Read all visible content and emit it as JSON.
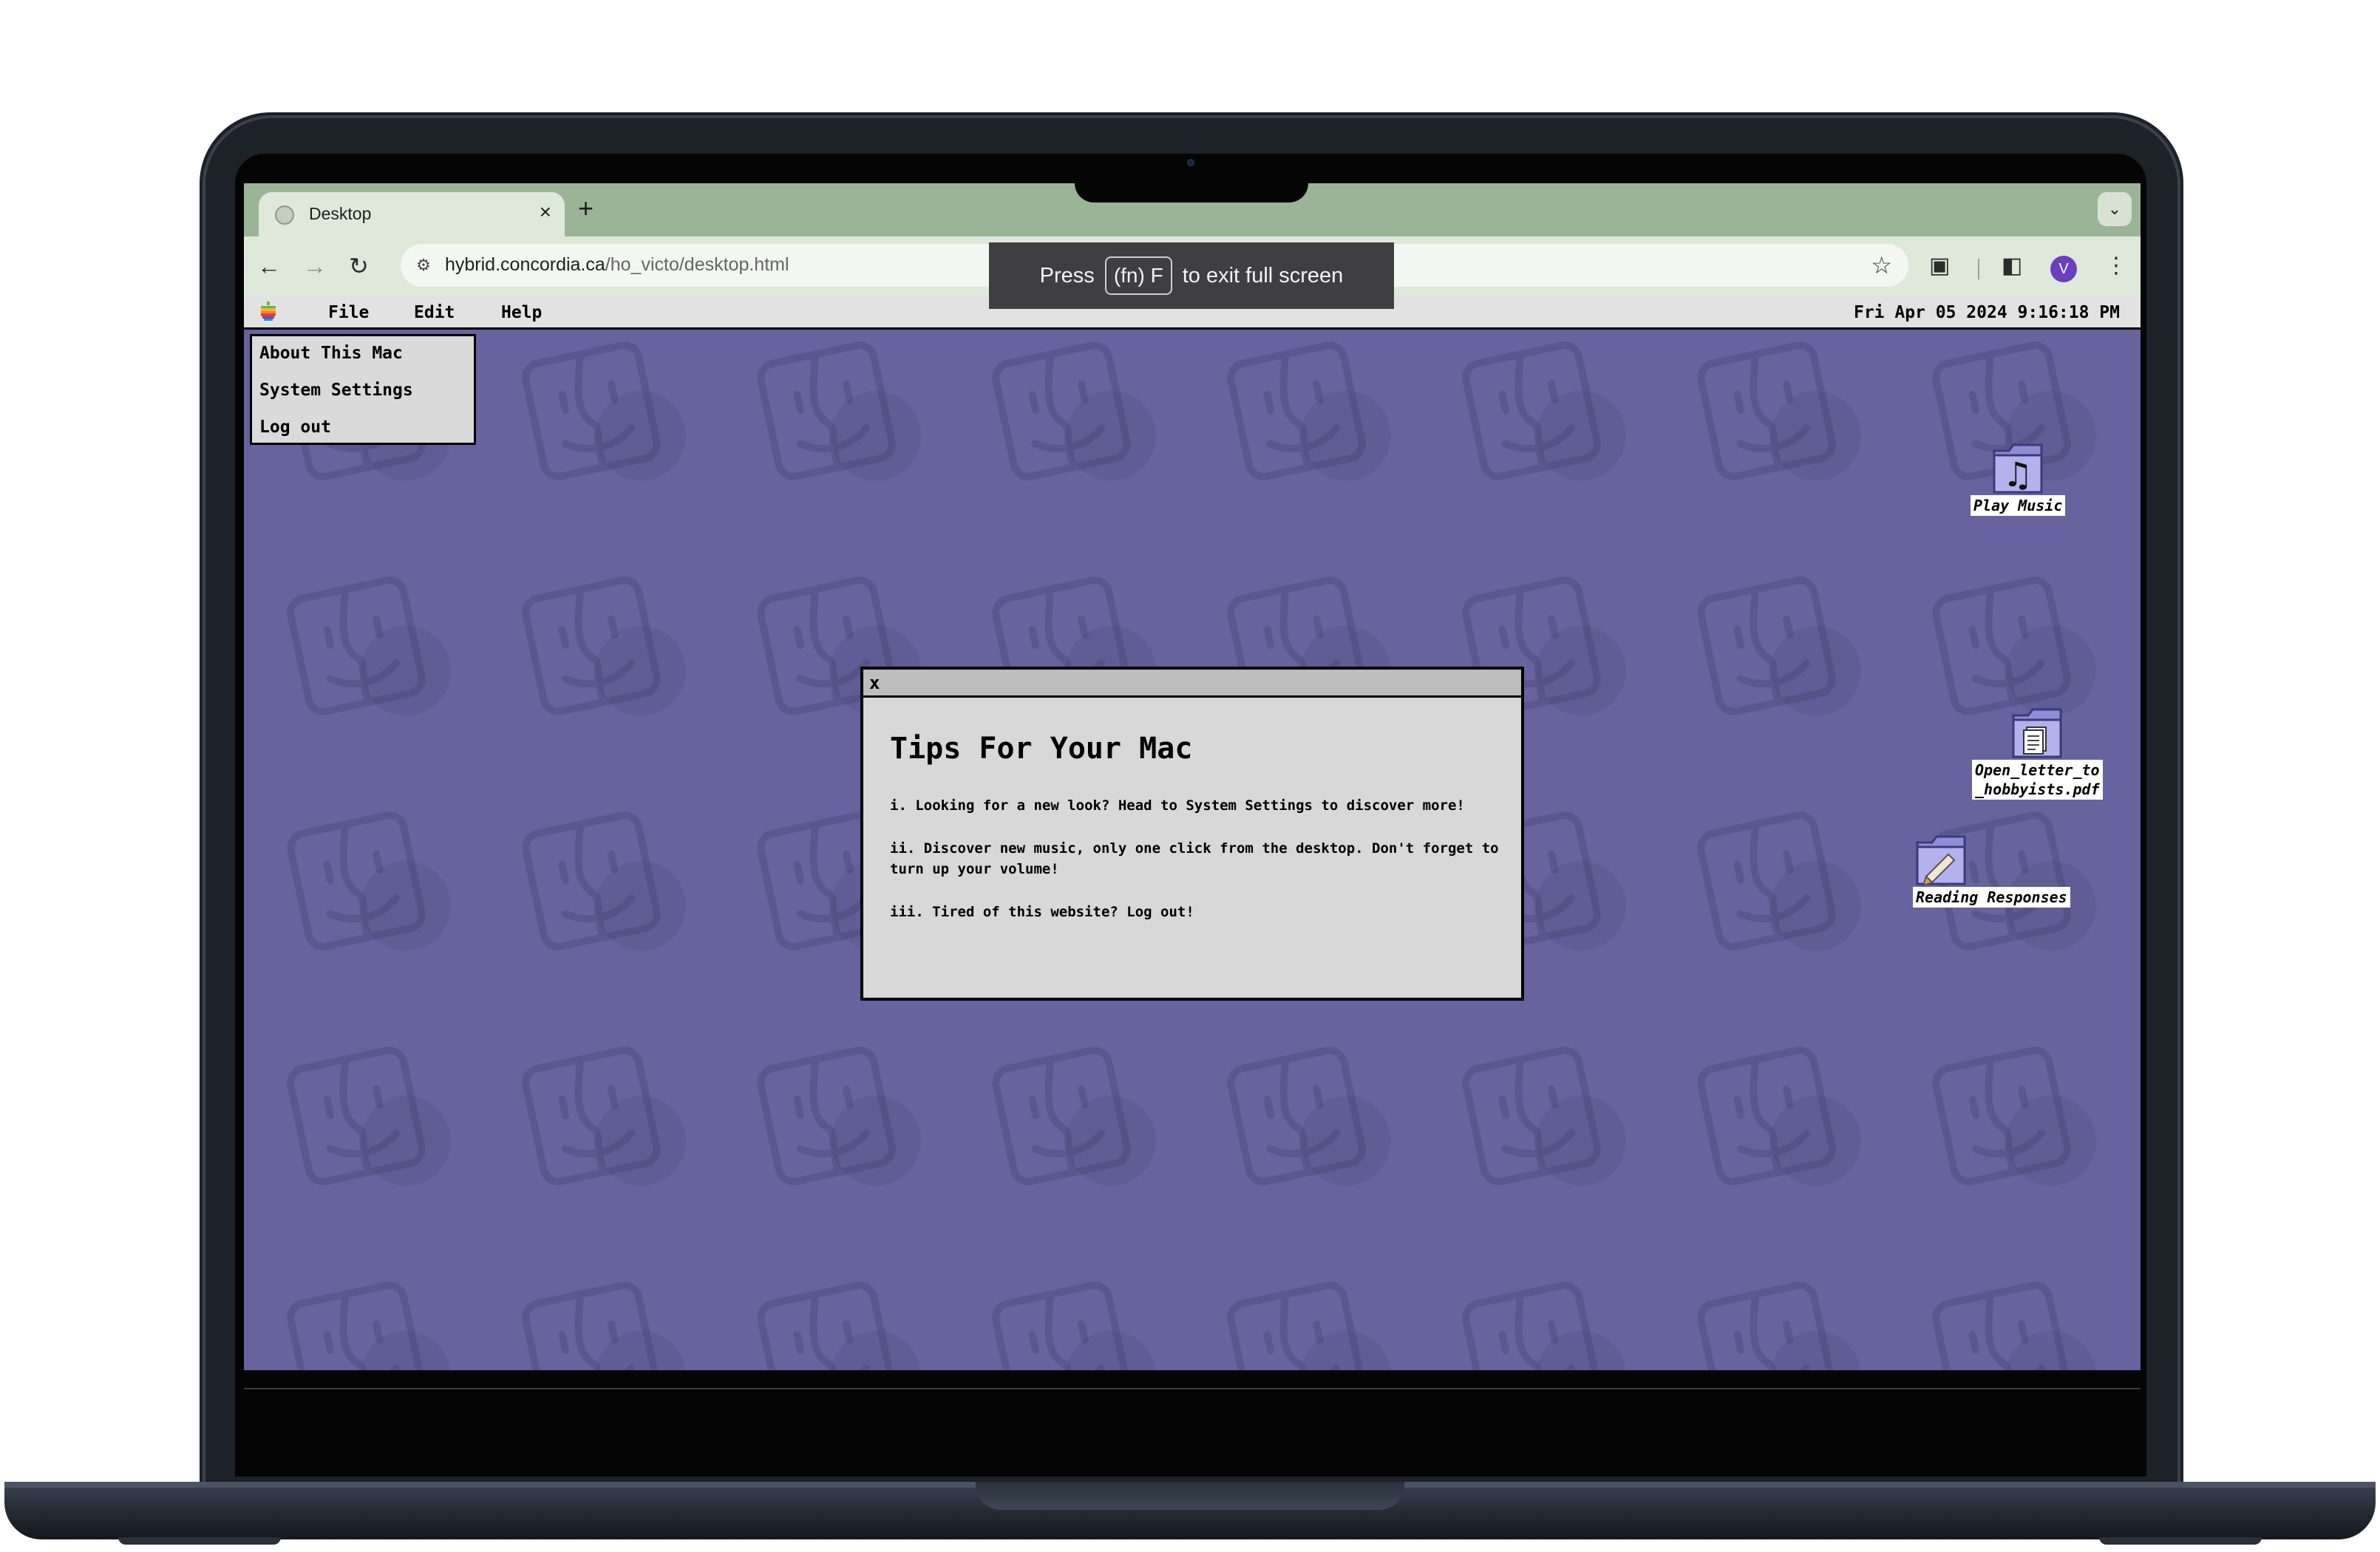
{
  "browser": {
    "tab_title": "Desktop",
    "tab_close": "×",
    "new_tab": "+",
    "tabs_menu": "⌄",
    "url_host": "hybrid.concordia.ca",
    "url_path": "/ho_victo/desktop.html",
    "profile_initial": "V",
    "accent_color": "#9ab595"
  },
  "fullscreen_banner": {
    "prefix": "Press",
    "key": "(fn) F",
    "suffix": "to exit full screen"
  },
  "menubar": {
    "items": [
      "File",
      "Edit",
      "Help"
    ],
    "clock": "Fri Apr 05 2024 9:16:18 PM",
    "apple_colors": [
      "#61bb46",
      "#fdb827",
      "#f5821f",
      "#e03a3e",
      "#963d97",
      "#009ddc"
    ]
  },
  "apple_menu": {
    "items": [
      "About This Mac",
      "System Settings",
      "Log out"
    ]
  },
  "desktop": {
    "background_color": "#66639f",
    "icons": [
      {
        "label": "Play Music",
        "icon": "music-note-icon"
      },
      {
        "label": "Open_letter_to\n_hobbyists.pdf",
        "icon": "document-icon"
      },
      {
        "label": "Reading Responses",
        "icon": "folder-icon"
      }
    ]
  },
  "tips_window": {
    "close": "x",
    "title": "Tips For Your Mac",
    "tips": [
      "i. Looking for a new look? Head to System Settings to discover more!",
      "ii. Discover new music, only one click from the desktop. Don't forget to turn up your volume!",
      "iii. Tired of this website? Log out!"
    ]
  }
}
